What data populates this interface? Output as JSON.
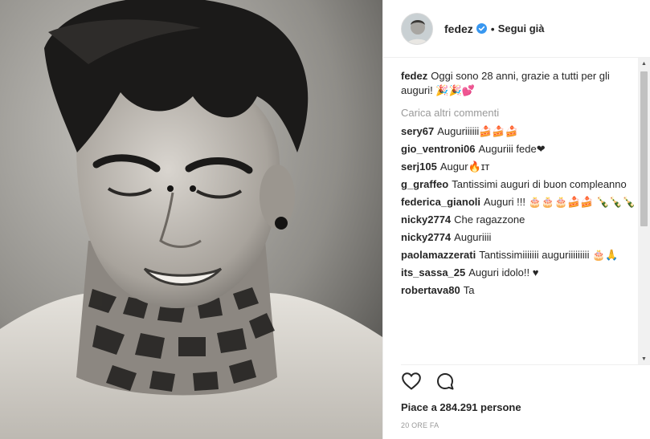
{
  "photo": {
    "alt_subject": "black-and-white portrait photo"
  },
  "header": {
    "username": "fedez",
    "separator": "•",
    "follow_label": "Segui già",
    "avatar_icon": "avatar-image",
    "verified_icon": "verified-badge-icon"
  },
  "caption": {
    "username": "fedez",
    "text": "Oggi sono 28 anni, grazie a tutti per gli auguri! 🎉🎉💕"
  },
  "load_more": "Carica altri commenti",
  "comments": [
    {
      "username": "sery67",
      "text": "Auguriiiiii🍰🍰🍰"
    },
    {
      "username": "gio_ventroni06",
      "text": "Auguriii fede❤"
    },
    {
      "username": "serj105",
      "text": "Augur🔥ɪᴛ"
    },
    {
      "username": "g_graffeo",
      "text": "Tantissimi auguri di buon compleanno"
    },
    {
      "username": "federica_gianoli",
      "text": "Auguri !!! 🎂🎂🎂🍰🍰 🍾🍾🍾"
    },
    {
      "username": "nicky2774",
      "text": "Che ragazzone"
    },
    {
      "username": "nicky2774",
      "text": "Auguriiii"
    },
    {
      "username": "paolamazzerati",
      "text": "Tantissimiiiiiii auguriiiiiiiii 🎂🙏"
    },
    {
      "username": "its_sassa_25",
      "text": "Auguri idolo!! ♥"
    },
    {
      "username": "robertava80",
      "text": "Ta"
    }
  ],
  "actions": {
    "like_icon": "heart-icon",
    "comment_icon": "comment-bubble-icon"
  },
  "likes": "Piace a 284.291 persone",
  "time": "20 ORE FA",
  "colors": {
    "text": "#262626",
    "muted": "#999999",
    "verified": "#3897f0",
    "border": "#efefef"
  }
}
